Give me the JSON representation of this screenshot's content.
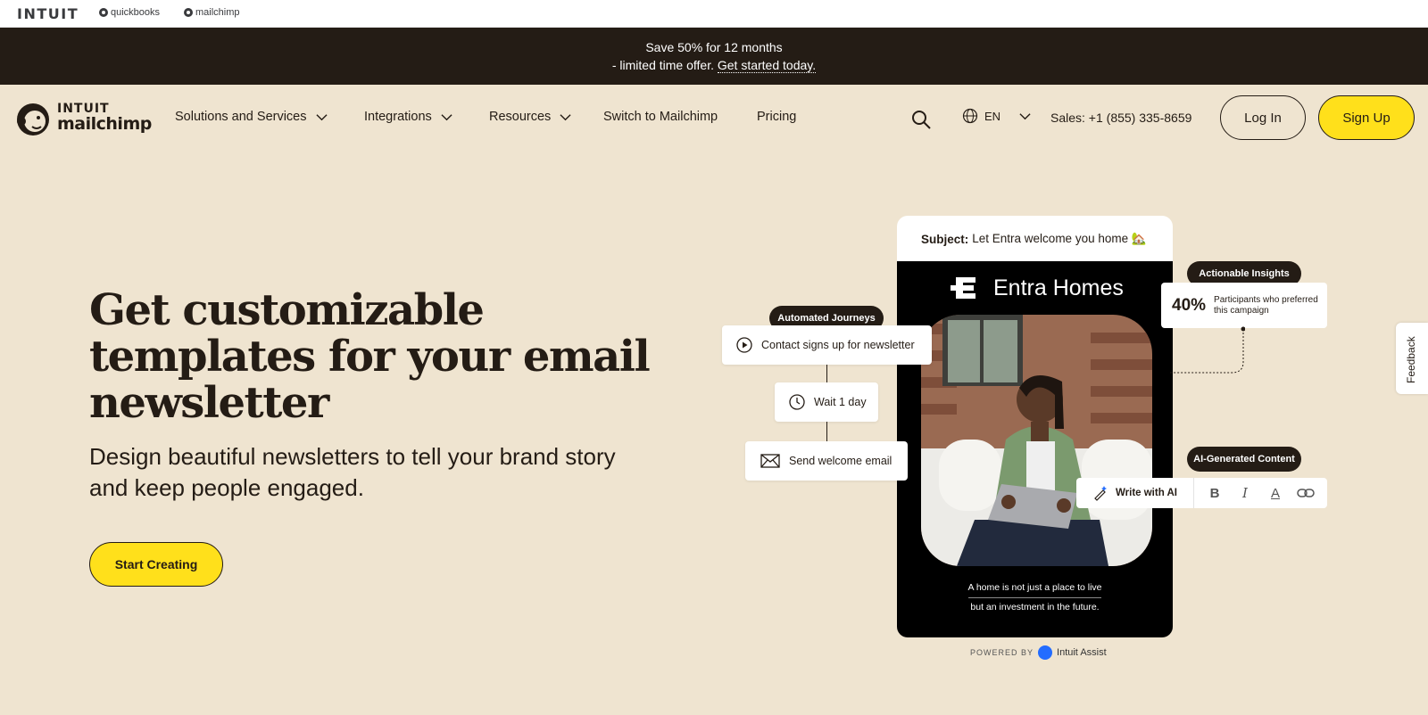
{
  "brandbar": {
    "intuit": "INTUIT",
    "quickbooks": "quickbooks",
    "mailchimp": "mailchimp"
  },
  "promo": {
    "line1": "Save 50% for 12 months",
    "line2_prefix": "- limited time offer. ",
    "link": "Get started today."
  },
  "nav": {
    "logo_top": "INTUIT",
    "logo_bottom": "mailchimp",
    "items": [
      {
        "label": "Solutions and Services",
        "dropdown": true
      },
      {
        "label": "Integrations",
        "dropdown": true
      },
      {
        "label": "Resources",
        "dropdown": true
      },
      {
        "label": "Switch to Mailchimp",
        "dropdown": false
      },
      {
        "label": "Pricing",
        "dropdown": false
      }
    ],
    "language": "EN",
    "sales": "Sales: +1 (855) 335-8659",
    "login": "Log In",
    "signup": "Sign Up"
  },
  "hero": {
    "title_line1": "Get customizable",
    "title_line2": "templates for your email",
    "title_line3": "newsletter",
    "subtitle_line1": "Design beautiful newsletters to tell your brand story",
    "subtitle_line2": "and keep people engaged.",
    "cta": "Start Creating"
  },
  "mockup": {
    "subject_label": "Subject:",
    "subject_text": "Let Entra welcome you home 🏡",
    "brand": "Entra Homes",
    "tagline1": "A home is not just a place to live",
    "tagline2": "but an investment in the future.",
    "powered_by": "POWERED BY",
    "assist": "Intuit Assist"
  },
  "journey": {
    "pill": "Automated Journeys",
    "step1": "Contact signs up for newsletter",
    "step2": "Wait 1 day",
    "step3": "Send welcome email"
  },
  "insights": {
    "pill": "Actionable Insights",
    "value": "40%",
    "text": "Participants who preferred this campaign"
  },
  "ai": {
    "pill": "AI-Generated Content",
    "write": "Write with AI",
    "bold": "B",
    "italic": "I",
    "color": "A"
  },
  "feedback": "Feedback",
  "colors": {
    "background": "#efe4d0",
    "dark": "#241c15",
    "accent_yellow": "#ffe01b"
  }
}
